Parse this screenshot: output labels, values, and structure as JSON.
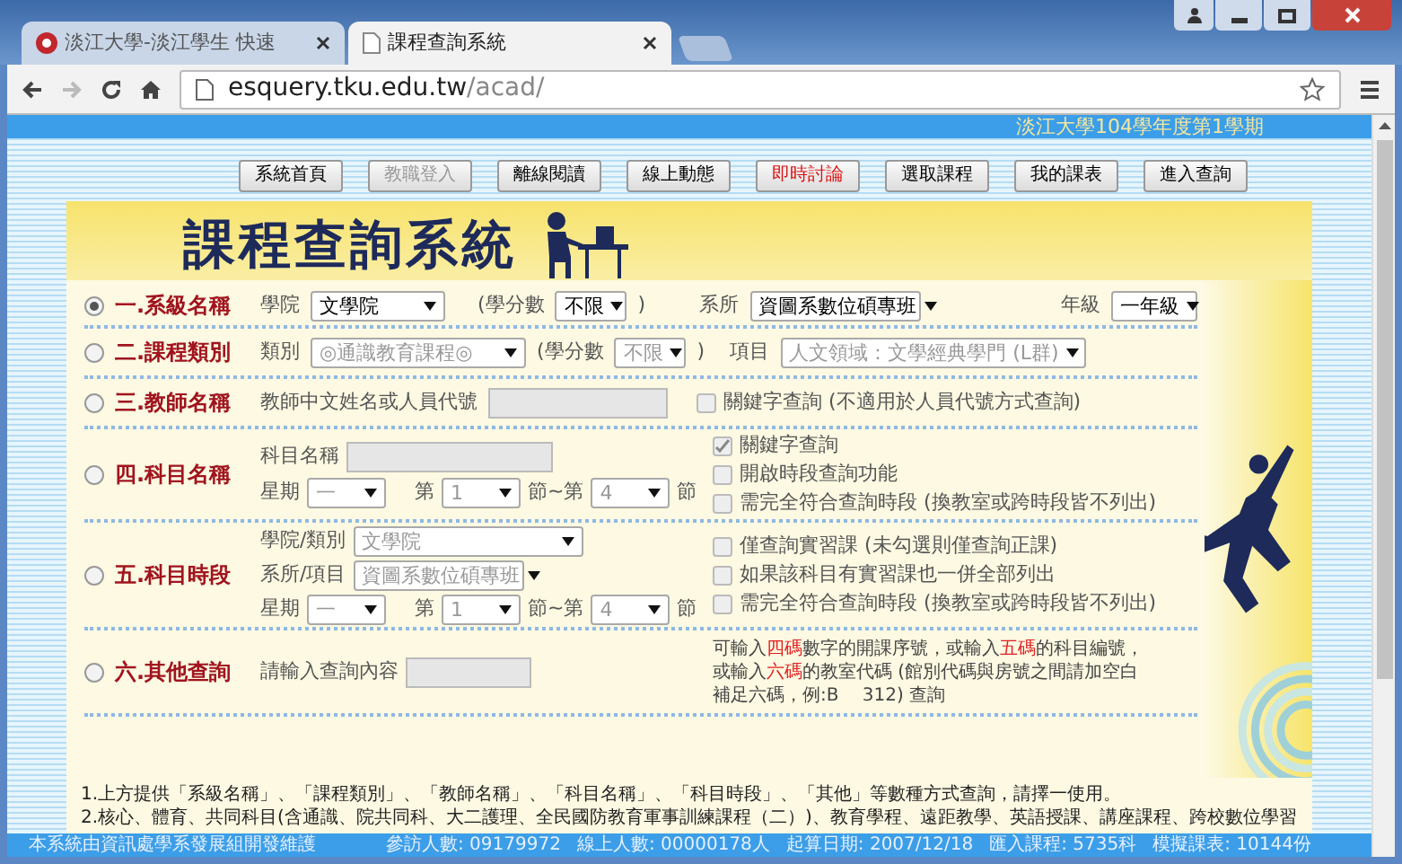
{
  "window": {
    "tabs": [
      {
        "title": "淡江大學-淡江學生 快速",
        "selected": false
      },
      {
        "title": "課程查詢系統",
        "selected": true
      }
    ],
    "address": {
      "host": "esquery.tku.edu.tw",
      "path": "/acad/"
    }
  },
  "page": {
    "semester": "淡江大學104學年度第1學期",
    "nav": [
      {
        "label": "系統首頁",
        "kind": "normal"
      },
      {
        "label": "教職登入",
        "kind": "disabled"
      },
      {
        "label": "離線閱讀",
        "kind": "normal"
      },
      {
        "label": "線上動態",
        "kind": "normal"
      },
      {
        "label": "即時討論",
        "kind": "alert"
      },
      {
        "label": "選取課程",
        "kind": "normal"
      },
      {
        "label": "我的課表",
        "kind": "normal"
      },
      {
        "label": "進入查詢",
        "kind": "normal"
      }
    ],
    "title": "課程查詢系統",
    "rows": [
      {
        "label": "一.系級名稱",
        "selected": true,
        "college_label": "學院",
        "college": "文學院",
        "credits_label": "(學分數",
        "credits": "不限",
        "credits_close": ")",
        "dept_label": "系所",
        "dept": "資圖系數位碩專班",
        "grade_label": "年級",
        "grade": "一年級"
      },
      {
        "label": "二.課程類別",
        "selected": false,
        "category_label": "類別",
        "category": "◎通識教育課程◎",
        "credits_label": "(學分數",
        "credits": "不限",
        "credits_close": ")",
        "item_label": "項目",
        "item": "人文領域：文學經典學門 (L群)"
      },
      {
        "label": "三.教師名稱",
        "selected": false,
        "teacher_label": "教師中文姓名或人員代號",
        "options": [
          {
            "label": "關鍵字查詢 (不適用於人員代號方式查詢)",
            "checked": false
          }
        ]
      },
      {
        "label": "四.科目名稱",
        "selected": false,
        "name_label": "科目名稱",
        "weekday_label": "星期",
        "weekday": "一",
        "from_label": "第",
        "from": "1",
        "to_label": "節~第",
        "to": "4",
        "end_label": "節",
        "options": [
          {
            "label": "關鍵字查詢",
            "checked": true
          },
          {
            "label": "開啟時段查詢功能",
            "checked": false
          },
          {
            "label": "需完全符合查詢時段 (換教室或跨時段皆不列出)",
            "checked": false
          }
        ]
      },
      {
        "label": "五.科目時段",
        "selected": false,
        "college_label": "學院/類別",
        "college": "文學院",
        "dept_label": "系所/項目",
        "dept": "資圖系數位碩專班",
        "weekday_label": "星期",
        "weekday": "一",
        "from_label": "第",
        "from": "1",
        "to_label": "節~第",
        "to": "4",
        "end_label": "節",
        "options": [
          {
            "label": "僅查詢實習課 (未勾選則僅查詢正課)",
            "checked": false
          },
          {
            "label": "如果該科目有實習課也一併全部列出",
            "checked": false
          },
          {
            "label": "需完全符合查詢時段 (換教室或跨時段皆不列出)",
            "checked": false
          }
        ]
      },
      {
        "label": "六.其他查詢",
        "selected": false,
        "query_label": "請輸入查詢內容",
        "hint": [
          {
            "text": "可輸入",
            "highlight": false
          },
          {
            "text": "四碼",
            "highlight": true
          },
          {
            "text": "數字的開課序號，或輸入",
            "highlight": false
          },
          {
            "text": "五碼",
            "highlight": true
          },
          {
            "text": "的科目編號，或輸入",
            "highlight": false
          },
          {
            "text": "六碼",
            "highlight": true
          },
          {
            "text": "的教室代碼 (館別代碼與房號之間請加空白補足六碼，例:B　 312) 查詢",
            "highlight": false
          }
        ]
      }
    ],
    "notes": [
      "1.上方提供「系級名稱」、「課程類別」、「教師名稱」、「科目名稱」、「科目時段」、「其他」等數種方式查詢，請擇一使用。",
      "2.核心、體育、共同科目(含通識、院共同科、大二護理、全民國防教育軍事訓練課程（二）)、教育學程、遠距教學、英語授課、講座課程、跨校數位學習"
    ],
    "footer": {
      "credit": "本系統由資訊處學系發展組開發維護",
      "stats": [
        "參訪人數: 09179972",
        "線上人數: 00000178人",
        "起算日期: 2007/12/18",
        "匯入課程: 5735科",
        "模擬課表: 10144份"
      ]
    }
  }
}
